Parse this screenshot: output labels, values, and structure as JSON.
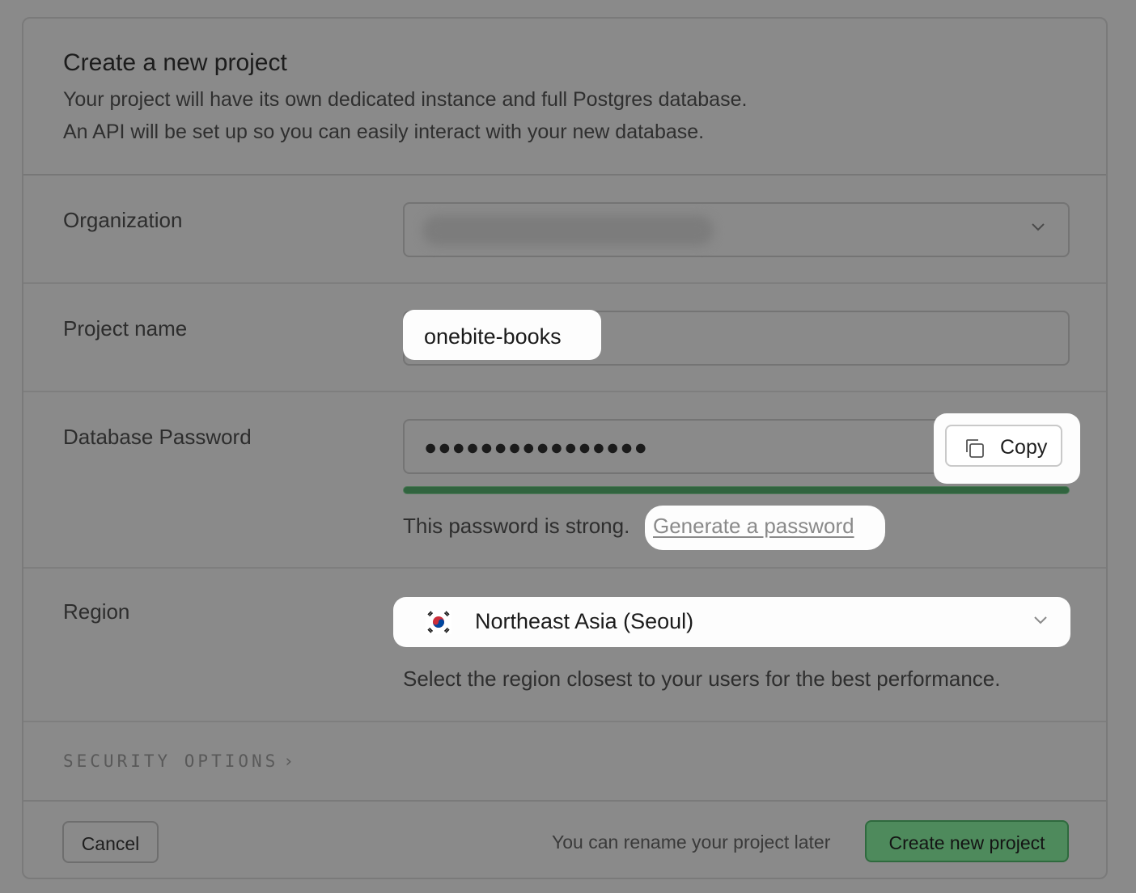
{
  "header": {
    "title": "Create a new project",
    "description_line1": "Your project will have its own dedicated instance and full Postgres database.",
    "description_line2": "An API will be set up so you can easily interact with your new database."
  },
  "organization": {
    "label": "Organization"
  },
  "project_name": {
    "label": "Project name",
    "value": "onebite-books"
  },
  "database_password": {
    "label": "Database Password",
    "value": "●●●●●●●●●●●●●●●●",
    "copy_label": "Copy",
    "strength_text": "This password is strong.",
    "strength_level": 1.0,
    "generate_link": "Generate a password"
  },
  "region": {
    "label": "Region",
    "flag": "south-korea-flag",
    "selected": "Northeast Asia (Seoul)",
    "help": "Select the region closest to your users for the best performance."
  },
  "security_options": {
    "label": "SECURITY OPTIONS",
    "chevron": "›"
  },
  "footer": {
    "cancel_label": "Cancel",
    "rename_note": "You can rename your project later",
    "create_label": "Create new project"
  },
  "colors": {
    "overlay": "#8a8a8a",
    "accent_green": "#4e8a5c",
    "strength_bar": "#31643f",
    "highlight": "#fdfdfd"
  }
}
